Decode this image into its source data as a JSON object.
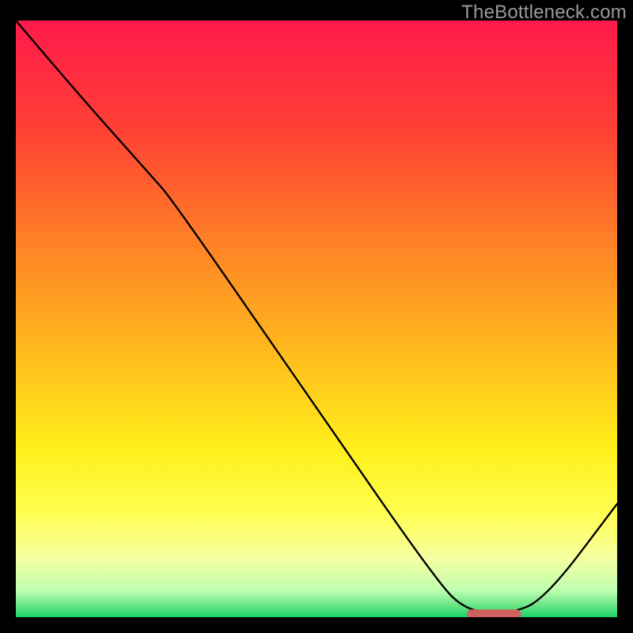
{
  "watermark": "TheBottleneck.com",
  "chart_data": {
    "type": "line",
    "title": "",
    "xlabel": "",
    "ylabel": "",
    "xlim": [
      0,
      100
    ],
    "ylim": [
      0,
      100
    ],
    "grid": false,
    "legend": false,
    "gradient_stops": [
      {
        "offset": 0.0,
        "color": "#ff1a4b"
      },
      {
        "offset": 0.18,
        "color": "#ff4035"
      },
      {
        "offset": 0.4,
        "color": "#ff8a25"
      },
      {
        "offset": 0.58,
        "color": "#ffc21c"
      },
      {
        "offset": 0.72,
        "color": "#fff01a"
      },
      {
        "offset": 0.83,
        "color": "#ffff55"
      },
      {
        "offset": 0.9,
        "color": "#f6ffa0"
      },
      {
        "offset": 0.955,
        "color": "#bfffb0"
      },
      {
        "offset": 0.985,
        "color": "#58e07e"
      },
      {
        "offset": 1.0,
        "color": "#18d36a"
      }
    ],
    "curve": {
      "x": [
        0.0,
        11.0,
        22.5,
        26.0,
        48.0,
        70.0,
        75.0,
        82.0,
        88.0,
        100.0
      ],
      "y": [
        100.0,
        87.0,
        74.0,
        70.0,
        38.0,
        6.0,
        1.0,
        0.5,
        3.0,
        19.0
      ]
    },
    "highlight_bar": {
      "x_start": 75.0,
      "x_end": 84.0,
      "y": 0.5,
      "color": "#d0605e"
    }
  }
}
